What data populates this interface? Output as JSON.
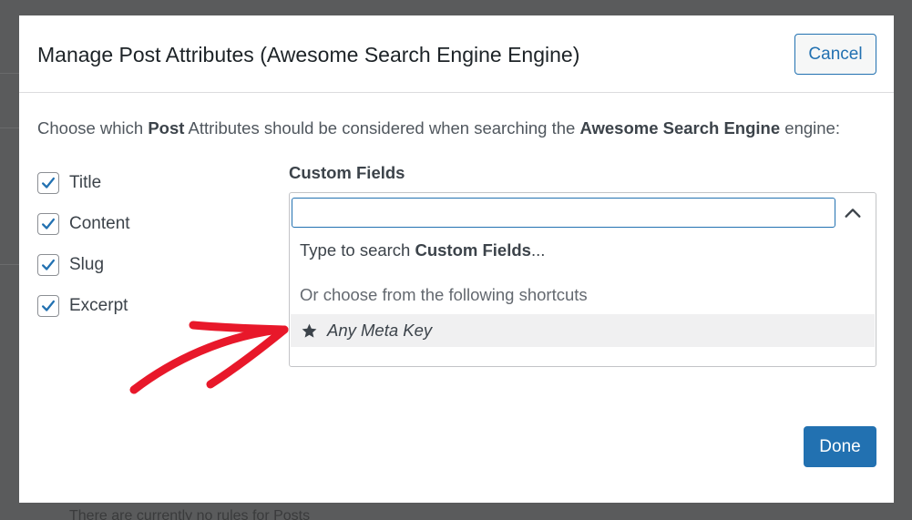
{
  "background": {
    "page_text": "There are currently no rules for Posts"
  },
  "modal": {
    "title": "Manage Post Attributes (Awesome Search Engine Engine)",
    "cancel_label": "Cancel",
    "done_label": "Done",
    "intro": {
      "part1": "Choose which ",
      "bold1": "Post",
      "part2": " Attributes should be considered when searching the ",
      "bold2": "Awesome Search Engine",
      "part3": " engine:"
    },
    "attributes": [
      {
        "label": "Title",
        "checked": true
      },
      {
        "label": "Content",
        "checked": true
      },
      {
        "label": "Slug",
        "checked": true
      },
      {
        "label": "Excerpt",
        "checked": true
      }
    ],
    "custom_fields": {
      "title": "Custom Fields",
      "search_value": "",
      "search_placeholder": "",
      "hint_prefix": "Type to search ",
      "hint_bold": "Custom Fields",
      "hint_suffix": "...",
      "shortcuts_label": "Or choose from the following shortcuts",
      "option_label": "Any Meta Key",
      "option_icon": "star-icon"
    }
  },
  "colors": {
    "accent": "#2271b1",
    "annotation_arrow": "#e8182a",
    "overlay": "#5a5b5c"
  }
}
